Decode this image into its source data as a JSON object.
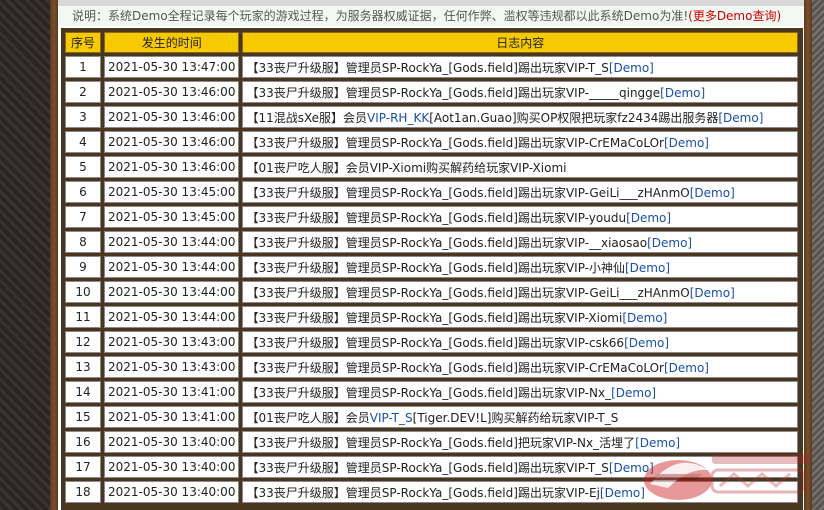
{
  "notice": {
    "text": "说明：系统Demo全程记录每个玩家的游戏过程，为服务器权威证据，任何作弊、滥权等违规都以此系统Demo为准!",
    "paren_open": "(",
    "link": "更多Demo查询",
    "paren_close": ")"
  },
  "table": {
    "headers": [
      "序号",
      "发生的时间",
      "日志内容"
    ],
    "rows": [
      {
        "n": "1",
        "time": "2021-05-30 13:47:00",
        "parts": [
          {
            "t": "【33丧尸升级服】管理员SP-RockYa_[Gods.field]踢出玩家VIP-T_S",
            "c": ""
          },
          {
            "t": "[Demo]",
            "c": "link"
          }
        ]
      },
      {
        "n": "2",
        "time": "2021-05-30 13:46:00",
        "parts": [
          {
            "t": "【33丧尸升级服】管理员SP-RockYa_[Gods.field]踢出玩家VIP-_____qingge",
            "c": ""
          },
          {
            "t": "[Demo]",
            "c": "link"
          }
        ]
      },
      {
        "n": "3",
        "time": "2021-05-30 13:46:00",
        "parts": [
          {
            "t": "【11混战sXe服】会员",
            "c": ""
          },
          {
            "t": "VIP-RH_KK",
            "c": "vip"
          },
          {
            "t": "[Aot1an.Guao]购买OP权限把玩家fz2434踢出服务器",
            "c": ""
          },
          {
            "t": "[Demo]",
            "c": "link"
          }
        ]
      },
      {
        "n": "4",
        "time": "2021-05-30 13:46:00",
        "parts": [
          {
            "t": "【33丧尸升级服】管理员SP-RockYa_[Gods.field]踢出玩家VIP-CrEMaCoLOr",
            "c": ""
          },
          {
            "t": "[Demo]",
            "c": "link"
          }
        ]
      },
      {
        "n": "5",
        "time": "2021-05-30 13:46:00",
        "parts": [
          {
            "t": "【01丧尸吃人服】会员VIP-Xiomi购买解药给玩家VIP-Xiomi",
            "c": ""
          }
        ]
      },
      {
        "n": "6",
        "time": "2021-05-30 13:45:00",
        "parts": [
          {
            "t": "【33丧尸升级服】管理员SP-RockYa_[Gods.field]踢出玩家VIP-GeiLi___zHAnmO",
            "c": ""
          },
          {
            "t": "[Demo]",
            "c": "link"
          }
        ]
      },
      {
        "n": "7",
        "time": "2021-05-30 13:45:00",
        "parts": [
          {
            "t": "【33丧尸升级服】管理员SP-RockYa_[Gods.field]踢出玩家VIP-youdu",
            "c": ""
          },
          {
            "t": "[Demo]",
            "c": "link"
          }
        ]
      },
      {
        "n": "8",
        "time": "2021-05-30 13:44:00",
        "parts": [
          {
            "t": "【33丧尸升级服】管理员SP-RockYa_[Gods.field]踢出玩家VIP-__xiaosao",
            "c": ""
          },
          {
            "t": "[Demo]",
            "c": "link"
          }
        ]
      },
      {
        "n": "9",
        "time": "2021-05-30 13:44:00",
        "parts": [
          {
            "t": "【33丧尸升级服】管理员SP-RockYa_[Gods.field]踢出玩家VIP-小神仙",
            "c": ""
          },
          {
            "t": "[Demo]",
            "c": "link"
          }
        ]
      },
      {
        "n": "10",
        "time": "2021-05-30 13:44:00",
        "parts": [
          {
            "t": "【33丧尸升级服】管理员SP-RockYa_[Gods.field]踢出玩家VIP-GeiLi___zHAnmO",
            "c": ""
          },
          {
            "t": "[Demo]",
            "c": "link"
          }
        ]
      },
      {
        "n": "11",
        "time": "2021-05-30 13:44:00",
        "parts": [
          {
            "t": "【33丧尸升级服】管理员SP-RockYa_[Gods.field]踢出玩家VIP-Xiomi",
            "c": ""
          },
          {
            "t": "[Demo]",
            "c": "link"
          }
        ]
      },
      {
        "n": "12",
        "time": "2021-05-30 13:43:00",
        "parts": [
          {
            "t": "【33丧尸升级服】管理员SP-RockYa_[Gods.field]踢出玩家VIP-csk66",
            "c": ""
          },
          {
            "t": "[Demo]",
            "c": "link"
          }
        ]
      },
      {
        "n": "13",
        "time": "2021-05-30 13:43:00",
        "parts": [
          {
            "t": "【33丧尸升级服】管理员SP-RockYa_[Gods.field]踢出玩家VIP-CrEMaCoLOr",
            "c": ""
          },
          {
            "t": "[Demo]",
            "c": "link"
          }
        ]
      },
      {
        "n": "14",
        "time": "2021-05-30 13:41:00",
        "parts": [
          {
            "t": "【33丧尸升级服】管理员SP-RockYa_[Gods.field]踢出玩家VIP-Nx_",
            "c": ""
          },
          {
            "t": "[Demo]",
            "c": "link"
          }
        ]
      },
      {
        "n": "15",
        "time": "2021-05-30 13:41:00",
        "parts": [
          {
            "t": "【01丧尸吃人服】会员",
            "c": ""
          },
          {
            "t": "VIP-T_S",
            "c": "vip"
          },
          {
            "t": "[Tiger.DEV!L]购买解药给玩家VIP-T_S",
            "c": ""
          }
        ]
      },
      {
        "n": "16",
        "time": "2021-05-30 13:40:00",
        "parts": [
          {
            "t": "【33丧尸升级服】管理员SP-RockYa_[Gods.field]把玩家VIP-Nx_活埋了",
            "c": ""
          },
          {
            "t": "[Demo]",
            "c": "link"
          }
        ]
      },
      {
        "n": "17",
        "time": "2021-05-30 13:40:00",
        "parts": [
          {
            "t": "【33丧尸升级服】管理员SP-RockYa_[Gods.field]踢出玩家VIP-T_S",
            "c": ""
          },
          {
            "t": "[Demo]",
            "c": "link"
          }
        ]
      },
      {
        "n": "18",
        "time": "2021-05-30 13:40:00",
        "parts": [
          {
            "t": "【33丧尸升级服】管理员SP-RockYa_[Gods.field]踢出玩家VIP-Ej",
            "c": ""
          },
          {
            "t": "[Demo]",
            "c": "link"
          }
        ]
      }
    ]
  },
  "colors": {
    "header_bg": "#f7c900",
    "table_frame": "#4a3520",
    "vip_link": "#1a4fa8",
    "notice_link": "#d00000"
  },
  "watermark": {
    "icon": "site-logo-watermark-icon"
  }
}
